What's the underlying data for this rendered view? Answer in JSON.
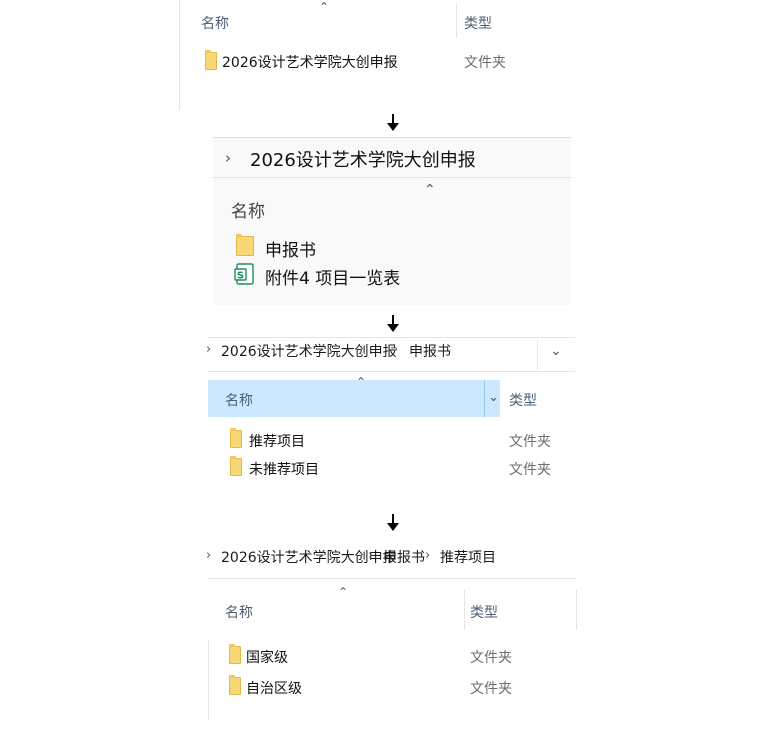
{
  "panel1": {
    "col_name": "名称",
    "col_type": "类型",
    "rows": [
      {
        "name": "2026设计艺术学院大创申报",
        "type": "文件夹"
      }
    ]
  },
  "panel2": {
    "breadcrumb": "2026设计艺术学院大创申报",
    "col_name": "名称",
    "rows": [
      {
        "name": "申报书",
        "icon": "folder-icon"
      },
      {
        "name": "附件4 项目一览表",
        "icon": "spreadsheet-icon"
      }
    ]
  },
  "panel3": {
    "breadcrumb": [
      "2026设计艺术学院大创申报",
      "申报书"
    ],
    "col_name": "名称",
    "col_type": "类型",
    "rows": [
      {
        "name": "推荐项目",
        "type": "文件夹"
      },
      {
        "name": "未推荐项目",
        "type": "文件夹"
      }
    ]
  },
  "panel4": {
    "breadcrumb": [
      "2026设计艺术学院大创申报",
      "申报书",
      "推荐项目"
    ],
    "col_name": "名称",
    "col_type": "类型",
    "rows": [
      {
        "name": "国家级",
        "type": "文件夹"
      },
      {
        "name": "自治区级",
        "type": "文件夹"
      }
    ]
  },
  "colors": {
    "folder": "#f8d775",
    "header_selected": "#cce8ff",
    "spreadsheet_green": "#1e8f5a"
  }
}
